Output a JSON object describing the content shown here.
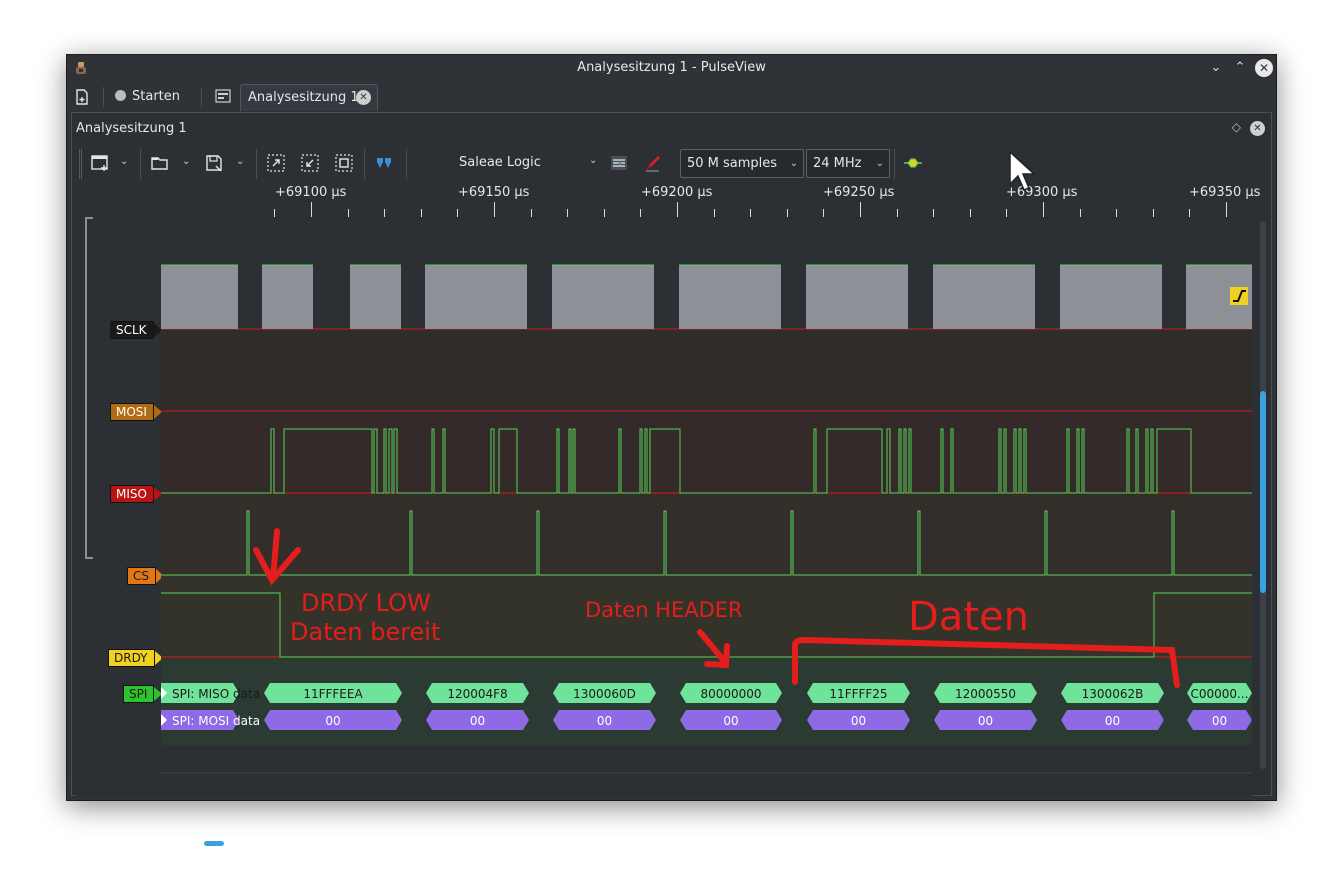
{
  "window": {
    "title": "Analysesitzung 1 - PulseView",
    "buttons": {
      "minimize": "⌄",
      "maximize": "⌃",
      "close": "✕"
    }
  },
  "tabs": {
    "start_label": "Starten",
    "session_label": "Analysesitzung 1"
  },
  "session": {
    "title": "Analysesitzung 1",
    "float_glyph": "◇"
  },
  "toolbar": {
    "device": "Saleae Logic",
    "samples": "50 M samples",
    "samplerate": "24 MHz",
    "caret": "⌄"
  },
  "ruler": {
    "labels": [
      "+69100 µs",
      "+69150 µs",
      "+69200 µs",
      "+69250 µs",
      "+69300 µs",
      "+69350 µs"
    ]
  },
  "channels": {
    "sclk": "SCLK",
    "mosi": "MOSI",
    "miso": "MISO",
    "cs": "CS",
    "drdy": "DRDY",
    "spi": "SPI"
  },
  "decoder": {
    "miso_row_label": "SPI: MISO data",
    "mosi_row_label": "SPI: MOSI data",
    "miso_values": [
      "11FFFEEA",
      "120004F8",
      "1300060D",
      "80000000",
      "11FFFF25",
      "12000550",
      "1300062B",
      "C00000..."
    ],
    "mosi_values": [
      "00",
      "00",
      "00",
      "00",
      "00",
      "00",
      "00",
      "00"
    ],
    "miso_color": "#6fe39a",
    "mosi_color": "#8f6ae6"
  },
  "annotations": {
    "drdy_low": "DRDY LOW",
    "daten_bereit": "Daten bereit",
    "daten_header": "Daten HEADER",
    "daten": "Daten"
  },
  "colors": {
    "signal": "#59d15a",
    "baseline": "#d61c1c",
    "annotation": "#e41d1d",
    "scroll": "#3aa0e0"
  }
}
